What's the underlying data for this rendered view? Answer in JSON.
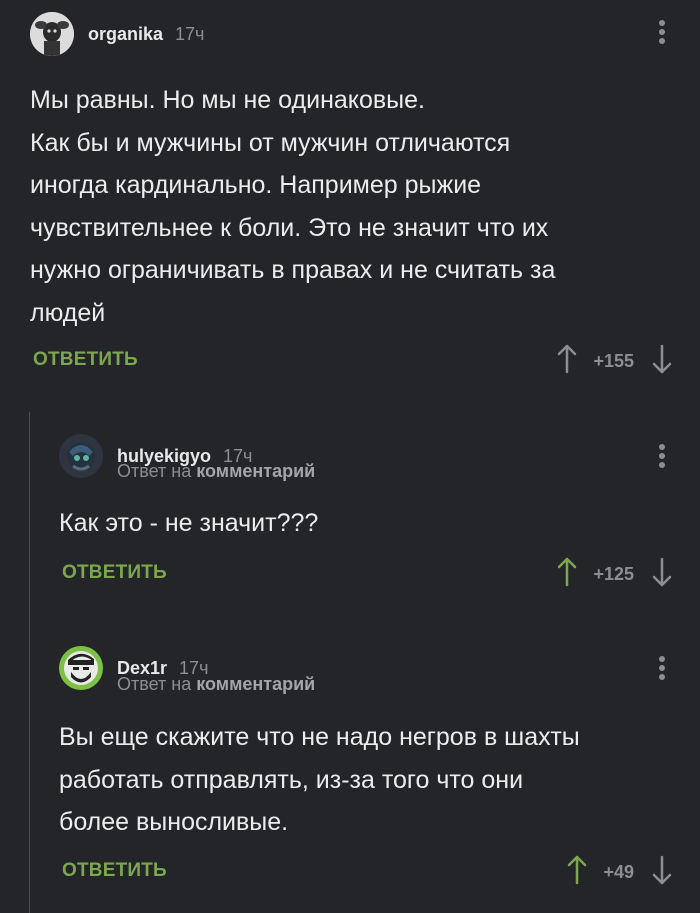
{
  "comments": [
    {
      "author": "organika",
      "time": "17ч",
      "text": "Мы равны. Но мы не одинаковые.\nКак бы и мужчины от мужчин отличаются\nиногда кардинально. Например рыжие\nчувствительнее к боли. Это не значит что их\nнужно ограничивать в правах и не считать за\nлюдей",
      "reply_label": "ОТВЕТИТЬ",
      "score": "+155",
      "upvoted": false
    },
    {
      "author": "hulyekigyo",
      "time": "17ч",
      "reply_prefix": "Ответ на",
      "reply_link": "комментарий",
      "text": "Как это - не значит???",
      "reply_label": "ОТВЕТИТЬ",
      "score": "+125",
      "upvoted": true
    },
    {
      "author": "Dex1r",
      "time": "17ч",
      "reply_prefix": "Ответ на",
      "reply_link": "комментарий",
      "text": "Вы еще скажите что не надо негров в шахты\nработать отправлять, из-за того что они\nболее выносливые.",
      "reply_label": "ОТВЕТИТЬ",
      "score": "+49",
      "upvoted": true
    }
  ],
  "colors": {
    "background": "#232529",
    "accent_green": "#7da74f",
    "muted": "#8c8e92"
  },
  "icons": [
    "avatar-organika",
    "avatar-hulyekigyo",
    "avatar-dex1r",
    "kebab-menu-icon",
    "arrow-up-icon",
    "arrow-down-icon"
  ]
}
